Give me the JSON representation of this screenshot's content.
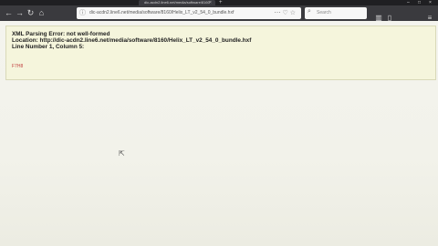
{
  "browser": {
    "tab_title": "dic-acdn2.line6.net/media/software/8160",
    "url": "dic-acdn2.line6.net/media/software/8160/Helix_LT_v2_54_0_bundle.hxf",
    "search_placeholder": "Search"
  },
  "error": {
    "title": "XML Parsing Error: not well-formed",
    "location": "Location: http://dic-acdn2.line6.net/media/software/8160/Helix_LT_v2_54_0_bundle.hxf",
    "line": "Line Number 1, Column 5:",
    "source": "F7H8"
  }
}
